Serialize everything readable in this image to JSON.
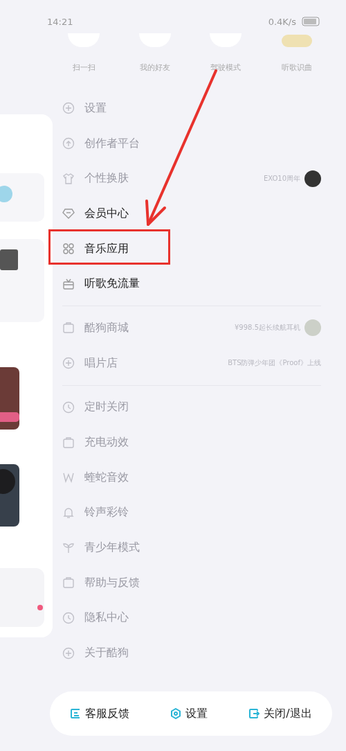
{
  "status_bar": {
    "time": "14:21",
    "speed": "0.4K/s"
  },
  "shortcuts": [
    {
      "label": "扫一扫",
      "badge": false
    },
    {
      "label": "我的好友",
      "badge": false
    },
    {
      "label": "驾驶模式",
      "badge": false
    },
    {
      "label": "听歌识曲",
      "badge": true
    }
  ],
  "menu_groups": [
    {
      "items": [
        {
          "label": "设置",
          "blurred": true
        },
        {
          "label": "创作者平台",
          "blurred": true
        },
        {
          "label": "个性换肤",
          "blurred": true,
          "note": "EXO10周年",
          "avatar": true
        },
        {
          "label": "会员中心",
          "blurred": false
        },
        {
          "label": "音乐应用",
          "blurred": false
        },
        {
          "label": "听歌免流量",
          "blurred": false
        }
      ]
    },
    {
      "items": [
        {
          "label": "酷狗商城",
          "blurred": true,
          "note": "¥998.5起长续航耳机",
          "avatar": true
        },
        {
          "label": "唱片店",
          "blurred": true,
          "note": "BTS防弹少年团《Proof》上线"
        }
      ]
    },
    {
      "items": [
        {
          "label": "定时关闭",
          "blurred": true
        },
        {
          "label": "充电动效",
          "blurred": true
        },
        {
          "label": "蝰蛇音效",
          "blurred": true
        },
        {
          "label": "铃声彩铃",
          "blurred": true
        },
        {
          "label": "青少年模式",
          "blurred": true
        },
        {
          "label": "帮助与反馈",
          "blurred": true
        },
        {
          "label": "隐私中心",
          "blurred": true
        },
        {
          "label": "关于酷狗",
          "blurred": true
        }
      ]
    }
  ],
  "bottom_bar": [
    {
      "label": "客服反馈"
    },
    {
      "label": "设置"
    },
    {
      "label": "关闭/退出"
    }
  ]
}
